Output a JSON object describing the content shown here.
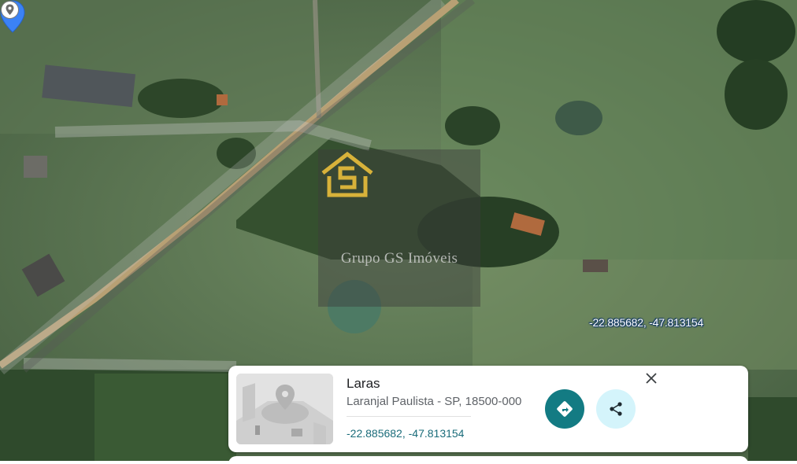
{
  "map": {
    "watermark_text": "Grupo GS Imóveis",
    "pin_coordinates_label": "-22.885682, -47.813154",
    "pin_icon": "map-pin-icon",
    "location_icon": "location-marker-icon"
  },
  "place_card": {
    "title": "Laras",
    "address": "Laranjal Paulista - SP, 18500-000",
    "coordinates": "-22.885682, -47.813154",
    "thumbnail_icon": "street-view-placeholder-icon",
    "directions_icon": "directions-icon",
    "share_icon": "share-icon",
    "close_icon": "close-icon"
  },
  "colors": {
    "directions_button": "#137b83",
    "share_button": "#d4f4fb",
    "coordinates_link": "#1a6c7a",
    "pin": "#3b82f6"
  }
}
